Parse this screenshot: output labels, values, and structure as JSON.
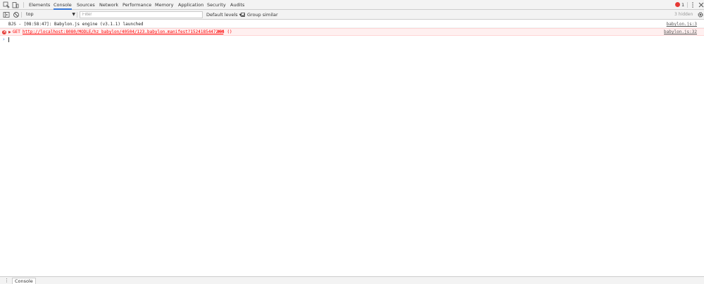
{
  "tabbar": {
    "tabs": [
      {
        "label": "Elements"
      },
      {
        "label": "Console"
      },
      {
        "label": "Sources"
      },
      {
        "label": "Network"
      },
      {
        "label": "Performance"
      },
      {
        "label": "Memory"
      },
      {
        "label": "Application"
      },
      {
        "label": "Security"
      },
      {
        "label": "Audits"
      }
    ],
    "active_tab": "Console",
    "error_count": "1",
    "accent_color": "#3879d9",
    "error_color": "#e53935"
  },
  "toolbar": {
    "context": "top",
    "filter_placeholder": "Filter",
    "levels_label": "Default levels ▾",
    "group_similar_label": "Group similar",
    "group_similar_checked": true,
    "hidden_label": "3 hidden"
  },
  "messages": [
    {
      "type": "log",
      "text": "BJS - [08:58:47]: Babylon.js engine (v3.1.1) launched",
      "source": "babylon.js:3"
    },
    {
      "type": "error",
      "method": "GET",
      "url": "http://localhost:8080/MODLE/hz_babylon/40504/123.babylon.manifest?1524185447244",
      "status": "404 ()",
      "source": "babylon.js:32"
    }
  ],
  "drawer": {
    "tab_label": "Console"
  }
}
